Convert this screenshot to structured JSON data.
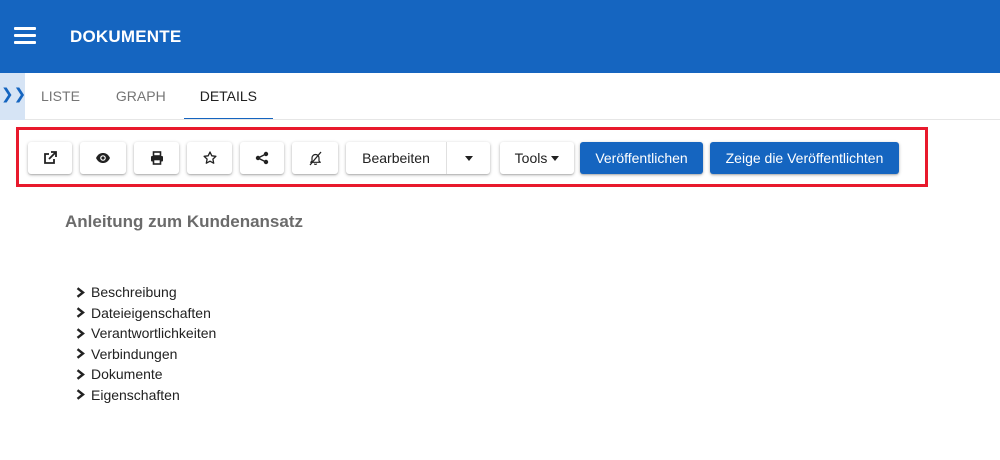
{
  "app": {
    "title": "DOKUMENTE"
  },
  "tabs": [
    {
      "label": "LISTE",
      "active": false
    },
    {
      "label": "GRAPH",
      "active": false
    },
    {
      "label": "DETAILS",
      "active": true
    }
  ],
  "toolbar": {
    "icons": [
      "external-link-icon",
      "eye-icon",
      "print-icon",
      "star-icon",
      "share-icon",
      "bell-slash-icon"
    ],
    "edit_label": "Bearbeiten",
    "tools_label": "Tools",
    "publish_label": "Veröffentlichen",
    "show_published_label": "Zeige die Veröffentlichten"
  },
  "document": {
    "title": "Anleitung zum Kundenansatz",
    "sections": [
      "Beschreibung",
      "Dateieigenschaften",
      "Verantwortlichkeiten",
      "Verbindungen",
      "Dokumente",
      "Eigenschaften"
    ]
  },
  "colors": {
    "primary": "#1565c0",
    "highlight": "#e8192c",
    "side_toggle": "#d6e4f5"
  }
}
